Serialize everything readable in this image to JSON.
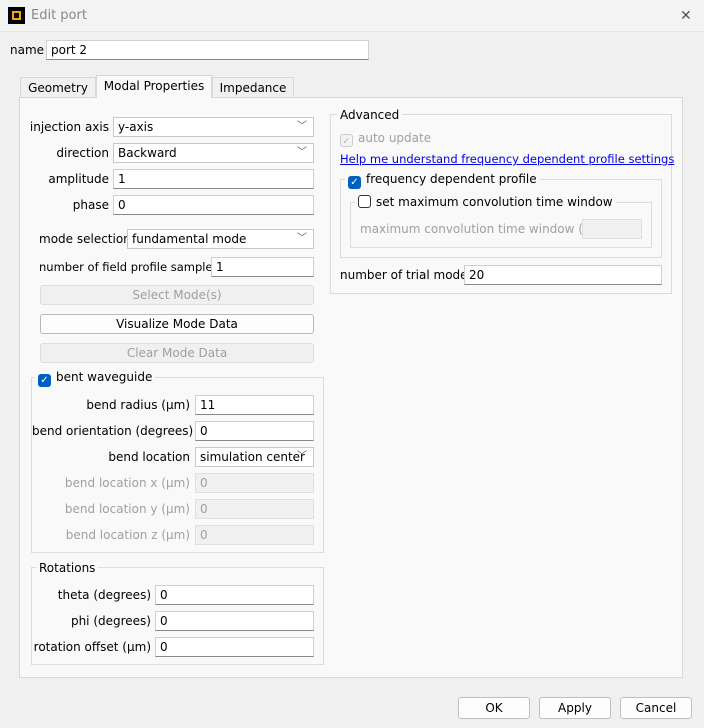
{
  "window": {
    "title": "Edit port",
    "close": "✕"
  },
  "name": {
    "label": "name",
    "value": "port 2"
  },
  "tabs": [
    {
      "label": "Geometry"
    },
    {
      "label": "Modal Properties"
    },
    {
      "label": "Impedance"
    }
  ],
  "modal": {
    "injection_axis": {
      "label": "injection axis",
      "value": "y-axis"
    },
    "direction": {
      "label": "direction",
      "value": "Backward"
    },
    "amplitude": {
      "label": "amplitude",
      "value": "1"
    },
    "phase": {
      "label": "phase",
      "value": "0"
    },
    "mode_selection": {
      "label": "mode selection",
      "value": "fundamental mode"
    },
    "field_samples": {
      "label": "number of field profile samples",
      "value": "1"
    },
    "select_mode": "Select Mode(s)",
    "visualize": "Visualize Mode Data",
    "clear": "Clear Mode Data",
    "bent": {
      "label": "bent waveguide",
      "checked": true,
      "radius": {
        "label": "bend radius (µm)",
        "value": "11"
      },
      "orientation": {
        "label": "bend orientation (degrees)",
        "value": "0"
      },
      "location": {
        "label": "bend location",
        "value": "simulation center"
      },
      "lx": {
        "label": "bend location x (µm)",
        "value": "0"
      },
      "ly": {
        "label": "bend location y (µm)",
        "value": "0"
      },
      "lz": {
        "label": "bend location z (µm)",
        "value": "0"
      }
    },
    "rotations": {
      "title": "Rotations",
      "theta": {
        "label": "theta (degrees)",
        "value": "0"
      },
      "phi": {
        "label": "phi (degrees)",
        "value": "0"
      },
      "offset": {
        "label": "rotation offset (µm)",
        "value": "0"
      }
    },
    "advanced": {
      "title": "Advanced",
      "auto_update": {
        "label": "auto update",
        "checked": true
      },
      "help_link": "Help me understand frequency dependent profile settings",
      "freq_profile": {
        "label": "frequency dependent profile",
        "checked": true
      },
      "set_max": {
        "label": "set maximum convolution time window",
        "checked": false
      },
      "max_window": {
        "label": "maximum convolution time window (fs)",
        "value": ""
      },
      "trial_modes": {
        "label": "number of trial modes",
        "value": "20"
      }
    }
  },
  "buttons": {
    "ok": "OK",
    "apply": "Apply",
    "cancel": "Cancel"
  },
  "colors": {
    "accent": "#0060c0",
    "link": "#0000ee"
  }
}
